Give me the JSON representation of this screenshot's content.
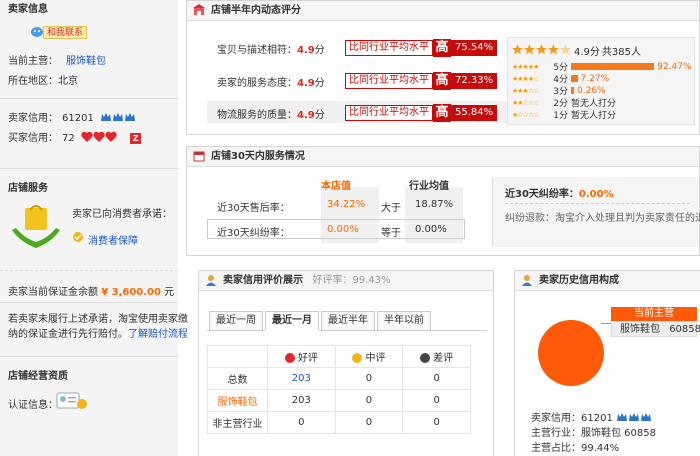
{
  "sidebar": {
    "seller_info": {
      "title": "卖家信息",
      "contact": "和我联系",
      "main_business_label": "当前主营：",
      "main_business": "服饰鞋包",
      "location_label": "所在地区：",
      "location": "北京",
      "seller_credit_label": "卖家信用：",
      "seller_credit": "61201",
      "buyer_credit_label": "买家信用：",
      "buyer_credit": "72"
    },
    "shop_service": {
      "title": "店铺服务",
      "promise_text": "卖家已向消费者承诺：",
      "guarantee_link": "消费者保障",
      "deposit_label": "卖家当前保证金余额",
      "deposit_value": "¥ 3,600.00",
      "deposit_unit": "元",
      "note_line1": "若卖家未履行上述承诺，淘宝使用卖家缴",
      "note_line2": "纳的保证金进行先行赔付。",
      "note_link": "了解赔付流程"
    },
    "qualification": {
      "title": "店铺经营资质",
      "cert_label": "认证信息："
    }
  },
  "dsr": {
    "title": "店铺半年内动态评分",
    "compare_label": "比同行业平均水平",
    "high_label": "高",
    "unit": "分",
    "rows": [
      {
        "label": "宝贝与描述相符：",
        "score": "4.9",
        "pct": "75.54%"
      },
      {
        "label": "卖家的服务态度：",
        "score": "4.9",
        "pct": "72.33%"
      },
      {
        "label": "物流服务的质量：",
        "score": "4.9",
        "pct": "55.84%"
      }
    ],
    "summary_score": "4.9分",
    "summary_count": "共385人",
    "distribution": [
      {
        "label": "5分",
        "pct": "92.47%",
        "value": 92.47
      },
      {
        "label": "4分",
        "pct": "7.27%",
        "value": 7.27
      },
      {
        "label": "3分",
        "pct": "0.26%",
        "value": 0.26
      },
      {
        "label": "2分",
        "pct": "暂无人打分",
        "value": 0
      },
      {
        "label": "1分",
        "pct": "暂无人打分",
        "value": 0
      }
    ]
  },
  "service30": {
    "title": "店铺30天内服务情况",
    "col_shop": "本店值",
    "col_industry": "行业均值",
    "rows": [
      {
        "label": "近30天售后率：",
        "shop": "34.22%",
        "cmp": "大于",
        "industry": "18.87%"
      },
      {
        "label": "近30天纠纷率：",
        "shop": "0.00%",
        "cmp": "等于",
        "industry": "0.00%"
      }
    ],
    "dispute_label": "近30天纠纷率：",
    "dispute_value": "0.00%",
    "refund_label": "纠纷退款：",
    "refund_desc": "淘宝介入处理且判为卖家责任的退款"
  },
  "rating": {
    "title": "卖家信用评价展示",
    "good_rate_label": "好评率：",
    "good_rate": "99.43%",
    "tabs": [
      "最近一周",
      "最近一月",
      "最近半年",
      "半年以前"
    ],
    "active_tab": 1,
    "headers": [
      "好评",
      "中评",
      "差评"
    ],
    "rows": [
      {
        "label": "总数",
        "good": "203",
        "mid": "0",
        "bad": "0"
      },
      {
        "label": "服饰鞋包",
        "good": "203",
        "mid": "0",
        "bad": "0"
      },
      {
        "label": "非主营行业",
        "good": "0",
        "mid": "0",
        "bad": "0"
      }
    ]
  },
  "history": {
    "title": "卖家历史信用构成",
    "legend_title": "当前主营",
    "legend_category": "服饰鞋包",
    "legend_value": "60858",
    "credit_label": "卖家信用：",
    "credit_value": "61201",
    "industry_label": "主营行业：",
    "industry_value": "服饰鞋包 60858",
    "ratio_label": "主营占比：",
    "ratio_value": "99.44%"
  },
  "colors": {
    "accent_red": "#c70a0a",
    "orange": "#f60",
    "link_blue": "#1a56c9"
  }
}
